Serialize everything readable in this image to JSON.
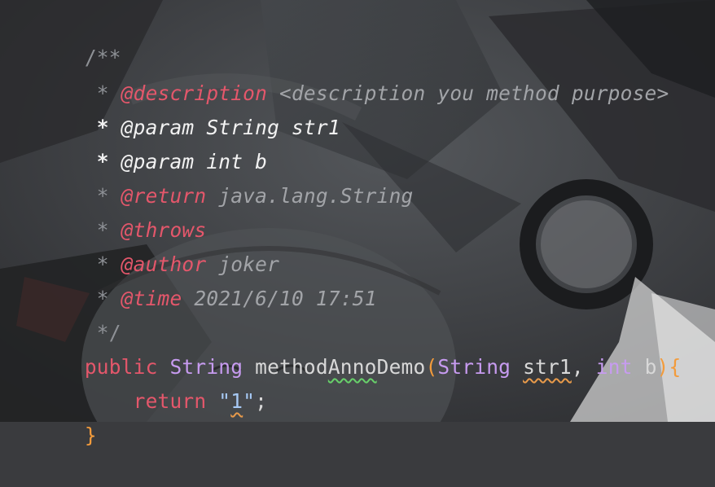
{
  "code": {
    "line1": {
      "comment_open": "/**"
    },
    "line2": {
      "star": " * ",
      "tag": "@description",
      "arg": " <description you method purpose>"
    },
    "line3": {
      "star": " * ",
      "tag": "@param",
      "arg": " String str1"
    },
    "line4": {
      "star": " * ",
      "tag": "@param",
      "arg": " int b"
    },
    "line5": {
      "star": " * ",
      "tag": "@return",
      "arg": " java.lang.String"
    },
    "line6": {
      "star": " * ",
      "tag": "@throws"
    },
    "line7": {
      "star": " * ",
      "tag": "@author",
      "arg": " joker"
    },
    "line8": {
      "star": " * ",
      "tag": "@time",
      "arg": " 2021/6/10 17:51"
    },
    "line9": {
      "comment_close": " */"
    },
    "line10": {
      "kw_public": "public",
      "sp1": " ",
      "type_string": "String",
      "sp2": " ",
      "method_name": "methodAnnoDemo",
      "paren_open": "(",
      "param_type1": "String",
      "sp3": " ",
      "param_name1": "str1",
      "comma": ", ",
      "param_type2": "int",
      "sp4": " ",
      "param_name2": "b",
      "paren_close": ")",
      "brace_open": "{"
    },
    "line11": {
      "indent": "    ",
      "kw_return": "return",
      "sp": " ",
      "quote_open": "\"",
      "literal": "1",
      "quote_close": "\"",
      "semicolon": ";"
    },
    "line12": {
      "brace_close": "}"
    }
  },
  "colors": {
    "background": "#3a3b3e",
    "keyword": "#e4576b",
    "type": "#c79bf0",
    "comment": "#8e9196",
    "string": "#a7c9f5",
    "brace": "#f39b3b",
    "warning_underline": "#67d06a"
  }
}
